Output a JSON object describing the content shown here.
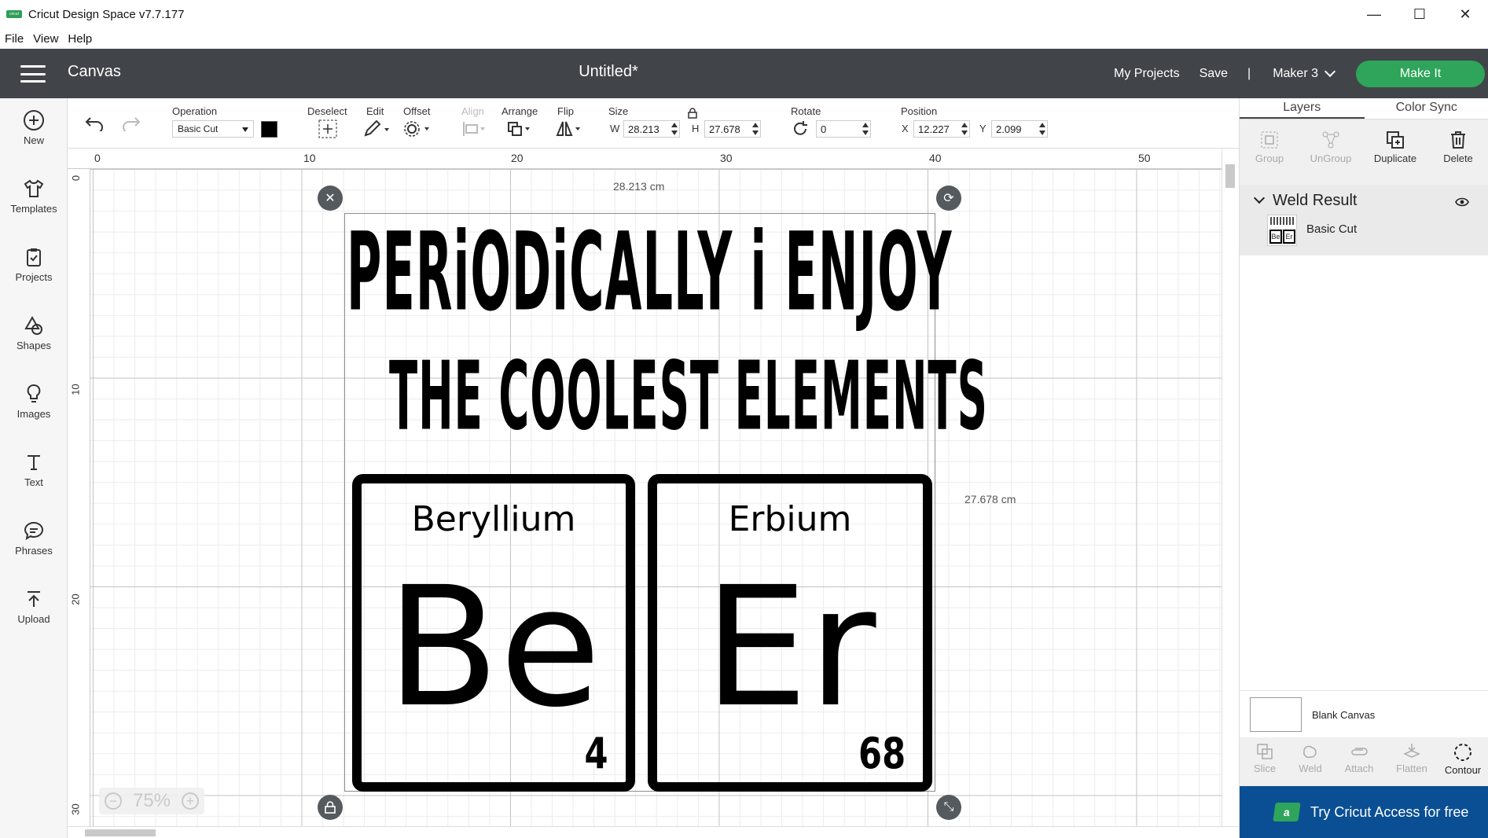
{
  "window": {
    "app_title": "Cricut Design Space  v7.7.177",
    "logo_text": "cricut",
    "minimize": "—",
    "maximize": "☐",
    "close": "✕"
  },
  "menu": [
    "File",
    "View",
    "Help"
  ],
  "header": {
    "section": "Canvas",
    "document": "Untitled*",
    "my_projects": "My Projects",
    "save": "Save",
    "separator": "|",
    "machine": "Maker 3",
    "make_it": "Make It"
  },
  "sidebar": [
    {
      "label": "New",
      "icon": "plus-circle-icon"
    },
    {
      "label": "Templates",
      "icon": "shirt-icon"
    },
    {
      "label": "Projects",
      "icon": "clipboard-icon"
    },
    {
      "label": "Shapes",
      "icon": "shapes-icon"
    },
    {
      "label": "Images",
      "icon": "lightbulb-icon"
    },
    {
      "label": "Text",
      "icon": "text-icon"
    },
    {
      "label": "Phrases",
      "icon": "speech-bubble-icon"
    },
    {
      "label": "Upload",
      "icon": "upload-icon"
    }
  ],
  "toolbar": {
    "operation_label": "Operation",
    "operation_value": "Basic Cut",
    "operation_color": "#000000",
    "deselect": "Deselect",
    "edit": "Edit",
    "offset": "Offset",
    "align": "Align",
    "arrange": "Arrange",
    "flip": "Flip",
    "size_label": "Size",
    "w_label": "W",
    "w_value": "28.213",
    "h_label": "H",
    "h_value": "27.678",
    "rotate_label": "Rotate",
    "rotate_value": "0",
    "position_label": "Position",
    "x_label": "X",
    "x_value": "12.227",
    "y_label": "Y",
    "y_value": "2.099"
  },
  "ruler": {
    "top": [
      "0",
      "10",
      "20",
      "30",
      "40",
      "50"
    ],
    "left": [
      "0",
      "10",
      "20",
      "30"
    ]
  },
  "canvas": {
    "width_dim": "28.213 cm",
    "height_dim": "27.678 cm",
    "headline_1": "PERiODiCALLY  i  ENJOY",
    "headline_2": "THE  COOLEST  ELEMENTS",
    "elements": [
      {
        "name": "Beryllium",
        "symbol": "Be",
        "number": "4"
      },
      {
        "name": "Erbium",
        "symbol": "Er",
        "number": "68"
      }
    ],
    "zoom": "75%"
  },
  "right_panel": {
    "tabs": [
      "Layers",
      "Color Sync"
    ],
    "actions": [
      "Group",
      "UnGroup",
      "Duplicate",
      "Delete"
    ],
    "group_title": "Weld Result",
    "layer_name": "Basic Cut",
    "thumb_be": "Be",
    "thumb_er": "Er",
    "blank_canvas": "Blank Canvas",
    "tools": [
      "Slice",
      "Weld",
      "Attach",
      "Flatten",
      "Contour"
    ],
    "promo": "Try Cricut Access for free",
    "promo_icon": "a"
  }
}
